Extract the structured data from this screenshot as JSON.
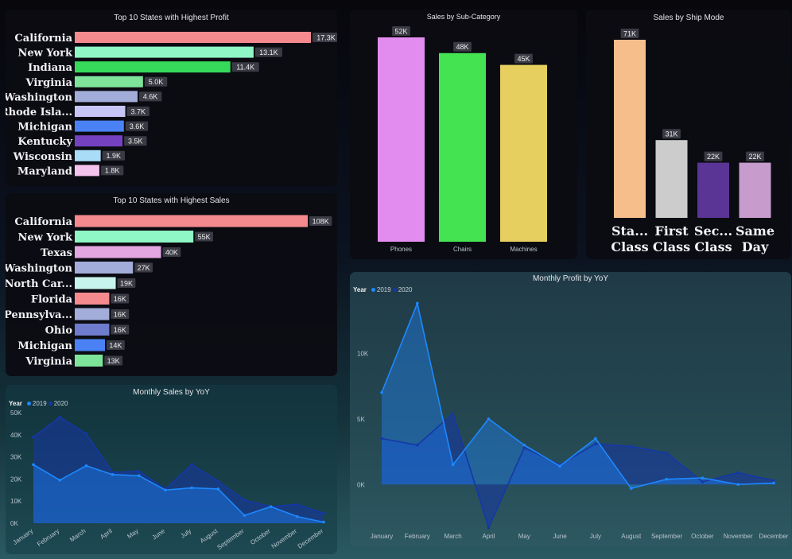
{
  "colors": {
    "c2019": "#1e88ff",
    "c2020": "#1537a8",
    "valbox": "#3a3a44"
  },
  "panels": {
    "profit_states_title": "Top 10 States with Highest Profit",
    "sales_states_title": "Top 10 States with Highest Sales",
    "subcat_title": "Sales by Sub-Category",
    "shipmode_title": "Sales by Ship Mode",
    "monthly_sales_title": "Monthly Sales by YoY",
    "monthly_profit_title": "Monthly Profit by YoY"
  },
  "legend": {
    "label": "Year",
    "y2019": "2019",
    "y2020": "2020"
  },
  "chart_data": [
    {
      "id": "profit_states",
      "type": "bar",
      "orientation": "horizontal",
      "title": "Top 10 States with Highest Profit",
      "categories": [
        "California",
        "New York",
        "Indiana",
        "Virginia",
        "Washington",
        "Rhode Isla...",
        "Michigan",
        "Kentucky",
        "Wisconsin",
        "Maryland"
      ],
      "values": [
        17300,
        13100,
        11400,
        5000,
        4600,
        3700,
        3600,
        3500,
        1900,
        1800
      ],
      "labels": [
        "17.3K",
        "13.1K",
        "11.4K",
        "5.0K",
        "4.6K",
        "3.7K",
        "3.6K",
        "3.5K",
        "1.9K",
        "1.8K"
      ],
      "colors": [
        "#f48a8e",
        "#8ef7c5",
        "#36d95a",
        "#7de49a",
        "#a3add9",
        "#c7c5f5",
        "#4a82f5",
        "#7442c0",
        "#a8dcf7",
        "#f3c3ee"
      ]
    },
    {
      "id": "sales_states",
      "type": "bar",
      "orientation": "horizontal",
      "title": "Top 10 States with Highest Sales",
      "categories": [
        "California",
        "New York",
        "Texas",
        "Washington",
        "North Car...",
        "Florida",
        "Pennsylva...",
        "Ohio",
        "Michigan",
        "Virginia"
      ],
      "values": [
        108000,
        55000,
        40000,
        27000,
        19000,
        16000,
        16000,
        16000,
        14000,
        13000
      ],
      "labels": [
        "108K",
        "55K",
        "40K",
        "27K",
        "19K",
        "16K",
        "16K",
        "16K",
        "14K",
        "13K"
      ],
      "colors": [
        "#f48a8e",
        "#8ef7c5",
        "#e3a6e0",
        "#a3add9",
        "#c8f4ee",
        "#f48a8e",
        "#a3add9",
        "#6f7bcc",
        "#4a82f5",
        "#7de49a"
      ]
    },
    {
      "id": "subcat",
      "type": "bar",
      "title": "Sales by Sub-Category",
      "categories": [
        "Phones",
        "Chairs",
        "Machines"
      ],
      "values": [
        52000,
        48000,
        45000
      ],
      "labels": [
        "52K",
        "48K",
        "45K"
      ],
      "colors": [
        "#e38cf0",
        "#44e352",
        "#e6cf5f"
      ]
    },
    {
      "id": "shipmode",
      "type": "bar",
      "title": "Sales by Ship Mode",
      "categories": [
        [
          "Sta...",
          "Class"
        ],
        [
          "First",
          "Class"
        ],
        [
          "Sec...",
          "Class"
        ],
        [
          "Same",
          "Day"
        ]
      ],
      "values": [
        71000,
        31000,
        22000,
        22000
      ],
      "labels": [
        "71K",
        "31K",
        "22K",
        "22K"
      ],
      "colors": [
        "#f5be8b",
        "#cccccc",
        "#5b3596",
        "#c79bcc"
      ]
    },
    {
      "id": "monthly_sales",
      "type": "area",
      "title": "Monthly Sales by YoY",
      "categories": [
        "January",
        "February",
        "March",
        "April",
        "May",
        "June",
        "July",
        "August",
        "September",
        "October",
        "November",
        "December"
      ],
      "yticks": [
        "0K",
        "10K",
        "20K",
        "30K",
        "40K",
        "50K"
      ],
      "ylim": [
        0,
        50000
      ],
      "series": [
        {
          "name": "2019",
          "values": [
            26500,
            19500,
            26000,
            22000,
            21500,
            15000,
            16000,
            15500,
            3500,
            7500,
            3000,
            500
          ]
        },
        {
          "name": "2020",
          "values": [
            39000,
            48000,
            40500,
            23000,
            23500,
            15500,
            26500,
            19000,
            10500,
            7500,
            8500,
            4500
          ]
        }
      ]
    },
    {
      "id": "monthly_profit",
      "type": "area",
      "title": "Monthly Profit by YoY",
      "categories": [
        "January",
        "February",
        "March",
        "April",
        "May",
        "June",
        "July",
        "August",
        "September",
        "October",
        "November",
        "December"
      ],
      "yticks": [
        "0K",
        "5K",
        "10K"
      ],
      "ylim": [
        -3500,
        14500
      ],
      "series": [
        {
          "name": "2019",
          "values": [
            7000,
            13800,
            1500,
            5000,
            3000,
            1400,
            3500,
            -300,
            400,
            500,
            0,
            100
          ]
        },
        {
          "name": "2020",
          "values": [
            3500,
            3000,
            5400,
            -3300,
            2800,
            1500,
            3100,
            2900,
            2400,
            200,
            900,
            300
          ]
        }
      ]
    }
  ]
}
